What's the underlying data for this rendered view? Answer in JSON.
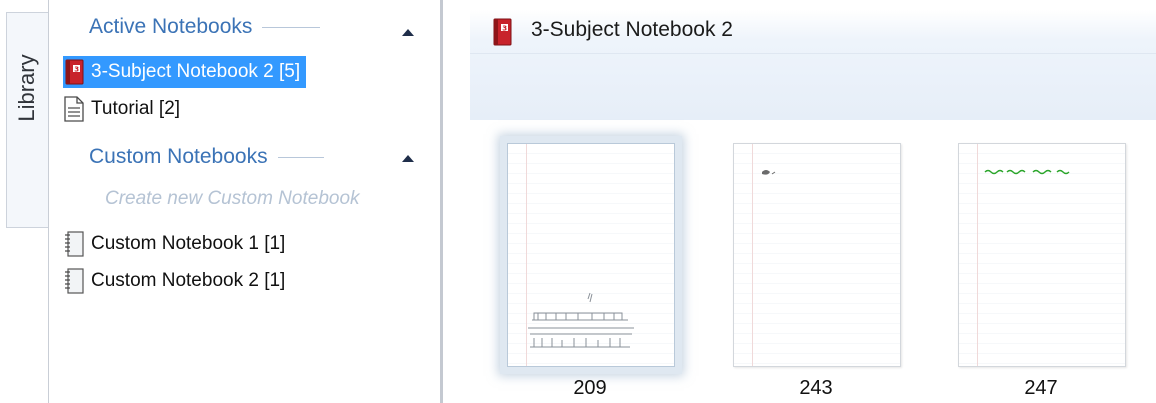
{
  "library_tab": {
    "label": "Library"
  },
  "sections": {
    "active": {
      "title": "Active Notebooks",
      "items": [
        {
          "label": "3-Subject Notebook 2 [5]",
          "selected": true,
          "icon": "red-notebook-icon"
        },
        {
          "label": "Tutorial [2]",
          "selected": false,
          "icon": "document-icon"
        }
      ]
    },
    "custom": {
      "title": "Custom Notebooks",
      "create_link": "Create new Custom Notebook",
      "items": [
        {
          "label": "Custom Notebook 1 [1]",
          "icon": "spiral-notebook-icon"
        },
        {
          "label": "Custom Notebook 2 [1]",
          "icon": "spiral-notebook-icon"
        }
      ]
    }
  },
  "content": {
    "title": "3-Subject Notebook 2",
    "title_icon": "red-notebook-icon",
    "pages": [
      {
        "number": "209",
        "selected": true
      },
      {
        "number": "243",
        "selected": false
      },
      {
        "number": "247",
        "selected": false
      }
    ]
  },
  "colors": {
    "accent": "#3399ff",
    "section_heading": "#3b73b6",
    "link_disabled": "#b5c3d4",
    "sketch_green": "#2aa52a"
  }
}
